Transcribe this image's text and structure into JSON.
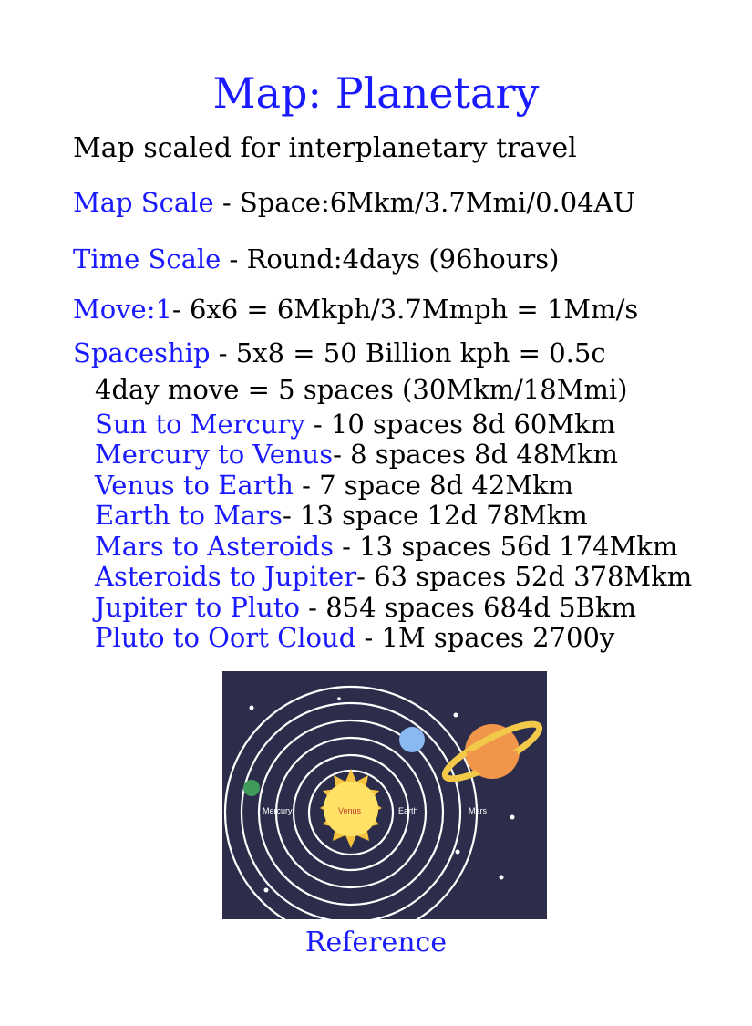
{
  "title": "Map: Planetary",
  "subtitle": "Map scaled for interplanetary travel",
  "map_scale": {
    "label": "Map Scale",
    "value": " - Space:6Mkm/3.7Mmi/0.04AU"
  },
  "time_scale": {
    "label": "Time Scale",
    "value": " - Round:4days (96hours)"
  },
  "move": {
    "label": "Move:1",
    "value": "- 6x6 = 6Mkph/3.7Mmph = 1Mm/s"
  },
  "spaceship": {
    "label": "Spaceship",
    "value": " - 5x8 = 50 Billion kph = 0.5c",
    "detail": "4day move = 5 spaces (30Mkm/18Mmi)"
  },
  "legs": [
    {
      "label": "Sun to Mercury",
      "value": " - 10 spaces 8d 60Mkm"
    },
    {
      "label": "Mercury to Venus",
      "value": "- 8 spaces 8d 48Mkm"
    },
    {
      "label": "Venus to Earth",
      "value": " - 7 space 8d 42Mkm"
    },
    {
      "label": "Earth to Mars",
      "value": "- 13 space 12d 78Mkm"
    },
    {
      "label": "Mars to Asteroids",
      "value": " - 13 spaces 56d 174Mkm"
    },
    {
      "label": "Asteroids to Jupiter",
      "value": "- 63 spaces 52d 378Mkm"
    },
    {
      "label": "Jupiter to Pluto",
      "value": " - 854 spaces 684d 5Bkm"
    },
    {
      "label": "Pluto to Oort Cloud",
      "value": " - 1M spaces 2700y"
    }
  ],
  "reference_image": {
    "labels": {
      "mercury": "Mercury",
      "venus": "Venus",
      "earth": "Earth",
      "mars": "Mars"
    },
    "colors": {
      "background": "#2b2d4a",
      "sun": "#f6c23e",
      "sun_core": "#ffe166",
      "planet_blue": "#8ab8f0",
      "planet_orange": "#f0954a",
      "ring": "#f3c94a",
      "planet_green": "#3f9a5c"
    }
  },
  "reference_link": "Reference"
}
